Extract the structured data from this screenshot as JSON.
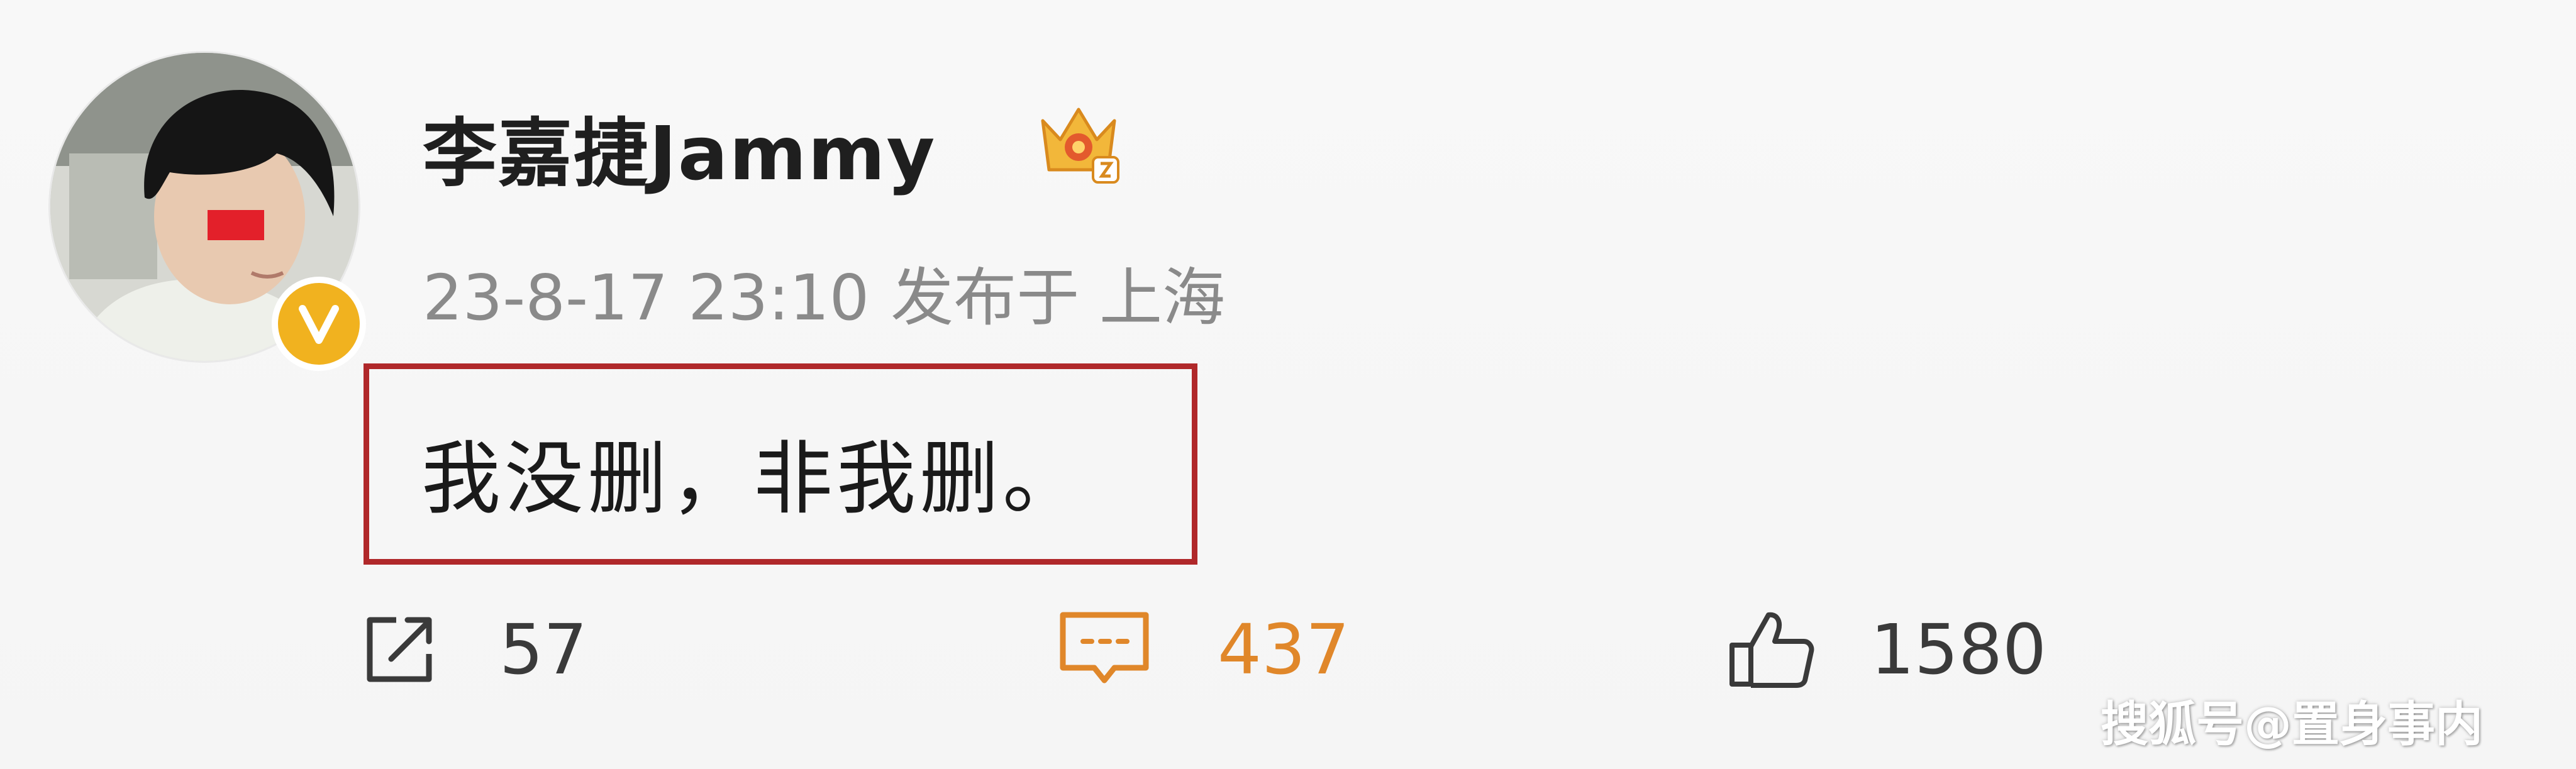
{
  "post": {
    "username": "李嘉捷Jammy",
    "timestamp": "23-8-17 23:10",
    "location": "发布于 上海",
    "text": "我没删，非我删。"
  },
  "actions": {
    "repost_count": "57",
    "comment_count": "437",
    "like_count": "1580"
  },
  "watermark": "搜狐号@置身事内",
  "icons": {
    "avatar": "avatar",
    "verified": "verified-v-icon",
    "crown": "crown-icon",
    "repost": "share-icon",
    "comment": "comment-icon",
    "like": "thumbs-up-icon"
  },
  "colors": {
    "highlight_box": "#b0282a",
    "comment_accent": "#e0872a",
    "verified_badge": "#f1b21f"
  }
}
